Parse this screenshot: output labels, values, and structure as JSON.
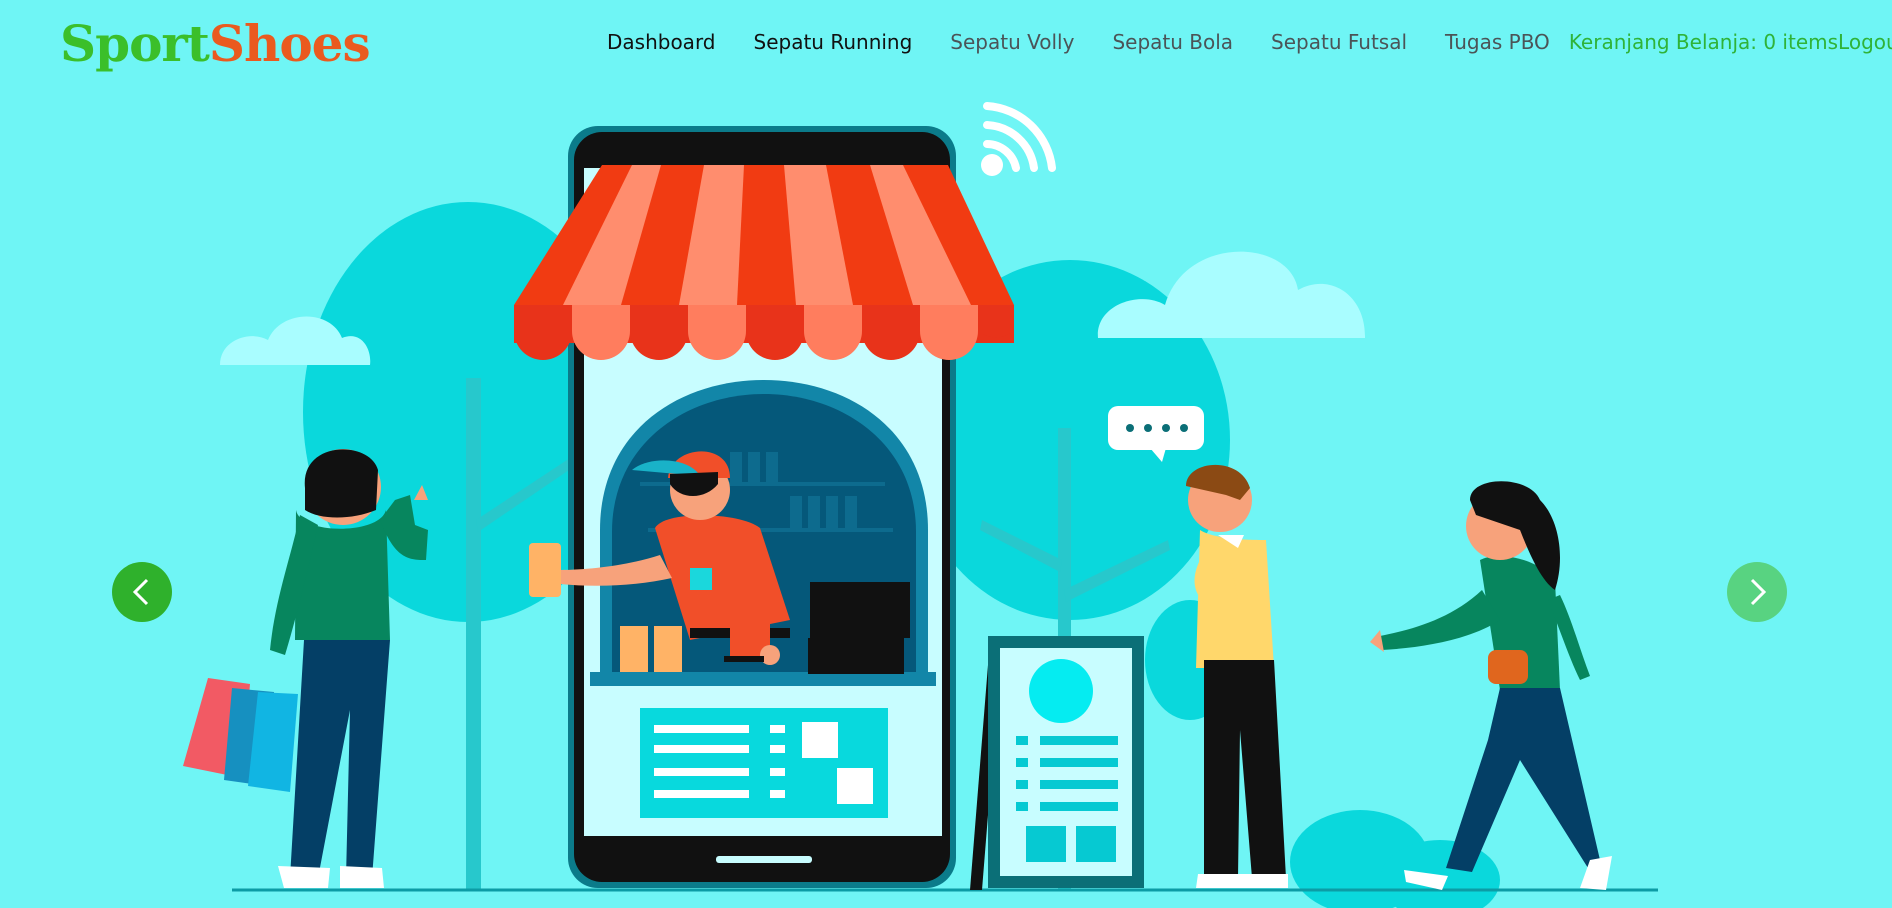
{
  "brand": {
    "part1": "Sport",
    "part2": "Shoes"
  },
  "nav": {
    "items": [
      {
        "label": "Dashboard"
      },
      {
        "label": "Sepatu Running"
      },
      {
        "label": "Sepatu Volly"
      },
      {
        "label": "Sepatu Bola"
      },
      {
        "label": "Sepatu Futsal"
      },
      {
        "label": "Tugas PBO"
      }
    ],
    "cart": "Keranjang Belanja: 0 items",
    "logout": "Logout"
  },
  "carousel": {
    "prev_icon": "chevron-left-icon",
    "next_icon": "chevron-right-icon",
    "colors": {
      "prev": "#2fb12c",
      "next": "#58d381"
    }
  },
  "colors": {
    "background": "#6ff5f5",
    "brand_green": "#3bbf2a",
    "brand_orange": "#ea5a1f",
    "link_green": "#2fb338"
  }
}
